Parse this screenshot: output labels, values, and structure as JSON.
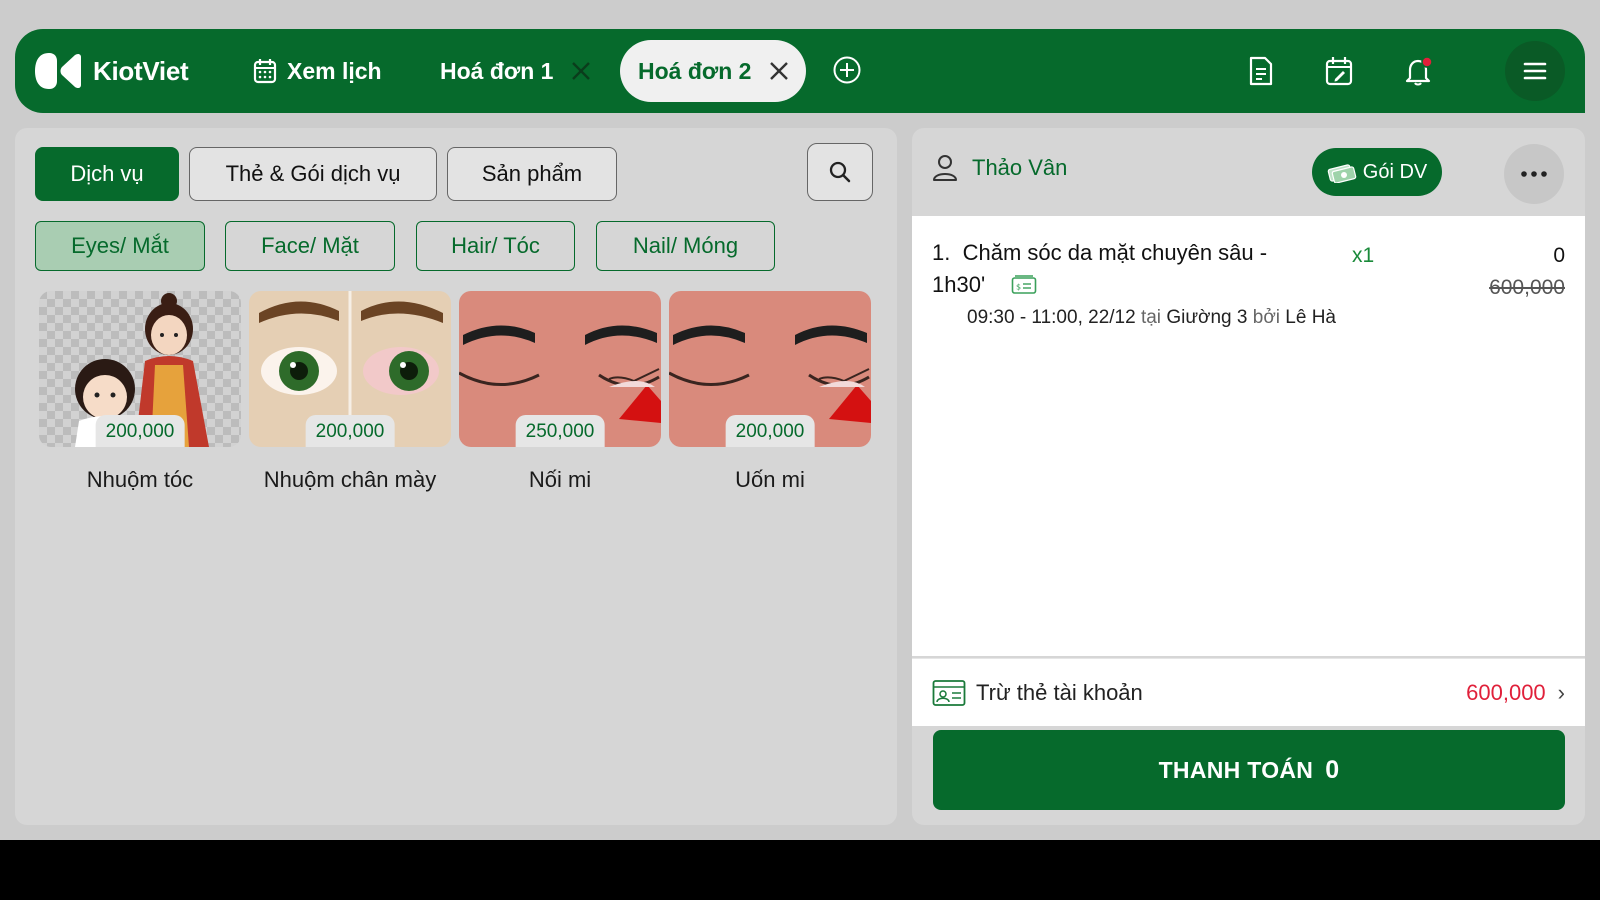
{
  "app": {
    "brand": "KiotViet",
    "tabs": [
      {
        "label": "Xem lịch",
        "icon": "calendar-icon"
      },
      {
        "label": "Hoá đơn 1",
        "icon": "close-icon"
      },
      {
        "label": "Hoá đơn 2",
        "icon": "close-icon",
        "active": true
      }
    ],
    "toolbar_icons": [
      "add-tab-icon",
      "document-icon",
      "calendar-edit-icon",
      "bell-icon",
      "menu-icon"
    ],
    "accent": "#066a2c",
    "alert": "#e0203a"
  },
  "left": {
    "segments": [
      "Dịch vụ",
      "Thẻ & Gói dịch vụ",
      "Sản phẩm"
    ],
    "active_segment": "Dịch vụ",
    "categories": [
      "Eyes/ Mắt",
      "Face/ Mặt",
      "Hair/ Tóc",
      "Nail/ Móng"
    ],
    "active_category": "Eyes/ Mắt",
    "services": [
      {
        "name": "Nhuộm tóc",
        "price": "200,000"
      },
      {
        "name": "Nhuộm chân mày",
        "price": "200,000"
      },
      {
        "name": "Nối mi",
        "price": "250,000"
      },
      {
        "name": "Uốn mi",
        "price": "200,000"
      }
    ]
  },
  "right": {
    "customer": "Thảo Vân",
    "package_button": "Gói DV",
    "items": [
      {
        "index": "1.",
        "name_line1": "Chăm sóc da mặt chuyên sâu -",
        "name_line2": "1h30'",
        "qty": "x1",
        "price": "0",
        "original_price": "600,000",
        "time": "09:30 - 11:00, 22/12",
        "at_word": "tại",
        "bed": "Giường 3",
        "by_word": "bởi",
        "staff": "Lê Hà"
      }
    ],
    "deduct_label": "Trừ thẻ tài khoản",
    "deduct_amount": "600,000",
    "pay_label": "THANH TOÁN",
    "pay_total": "0"
  }
}
